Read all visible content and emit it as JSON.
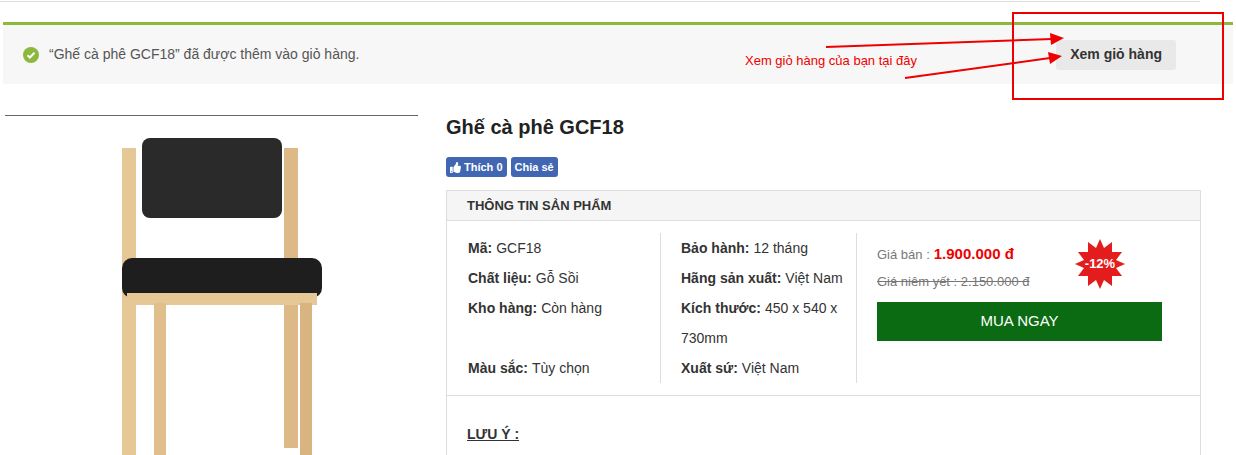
{
  "notice": {
    "message": "“Ghế cà phê GCF18” đã được thêm vào giỏ hàng.",
    "button": "Xem giỏ hàng"
  },
  "annotation": {
    "text": "Xem giỏ hàng của bạn tại đây"
  },
  "product": {
    "title": "Ghế cà phê GCF18",
    "social": [
      {
        "label": "Thích 0",
        "kind": "like"
      },
      {
        "label": "Chia sẻ",
        "kind": "share"
      }
    ],
    "info": {
      "heading": "THÔNG TIN SẢN PHẨM",
      "rows": [
        [
          {
            "label": "Mã:",
            "value": "GCF18"
          },
          {
            "label": "Bảo hành:",
            "value": "12 tháng"
          }
        ],
        [
          {
            "label": "Chất liệu:",
            "value": "Gỗ Sồi"
          },
          {
            "label": "Hãng sản xuất:",
            "value": "Việt Nam"
          }
        ],
        [
          {
            "label": "Kho hàng:",
            "value": "Còn hàng"
          },
          {
            "label": "Kích thước:",
            "value": "450 x 540 x 730mm"
          }
        ],
        [
          {
            "label": "Màu sắc:",
            "value": "Tùy chọn"
          },
          {
            "label": "Xuất sứ:",
            "value": "Việt Nam"
          }
        ]
      ]
    },
    "price": {
      "label": "Giá bán :",
      "value": "1.900.000 đ",
      "list_price": "Giá niêm yết : 2.150.000 đ",
      "discount": "-12%",
      "buy": "MUA NGAY"
    },
    "note": {
      "heading": "LƯU Ý :"
    }
  }
}
